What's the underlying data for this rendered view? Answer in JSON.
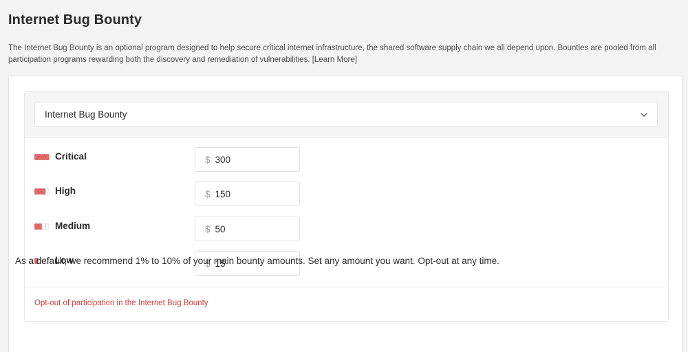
{
  "page": {
    "title": "Internet Bug Bounty",
    "description": "The Internet Bug Bounty is an optional program designed to help secure critical internet infrastructure, the shared software supply chain we all depend upon. Bounties are pooled from all participation programs rewarding both the discovery and remediation of vulnerabilities. [Learn More]"
  },
  "program_select": {
    "selected": "Internet Bug Bounty",
    "icon": "chevron-down-icon"
  },
  "severities": [
    {
      "label": "Critical",
      "currency": "$",
      "amount": "300",
      "level": 4,
      "icon": "severity-critical-icon"
    },
    {
      "label": "High",
      "currency": "$",
      "amount": "150",
      "level": 3,
      "icon": "severity-high-icon"
    },
    {
      "label": "Medium",
      "currency": "$",
      "amount": "50",
      "level": 2,
      "icon": "severity-medium-icon"
    },
    {
      "label": "Low",
      "currency": "$",
      "amount": "15",
      "level": 1,
      "icon": "severity-low-icon"
    }
  ],
  "opt_out_link": "Opt-out of participation in the Internet Bug Bounty",
  "footer_note": "As a default, we recommend 1% to 10% of your main bounty amounts. Set any amount you want. Opt-out at any time.",
  "colors": {
    "severity_filled": "#e56b6b",
    "severity_empty": "#d8d8d8",
    "link_red": "#d93a3a"
  }
}
